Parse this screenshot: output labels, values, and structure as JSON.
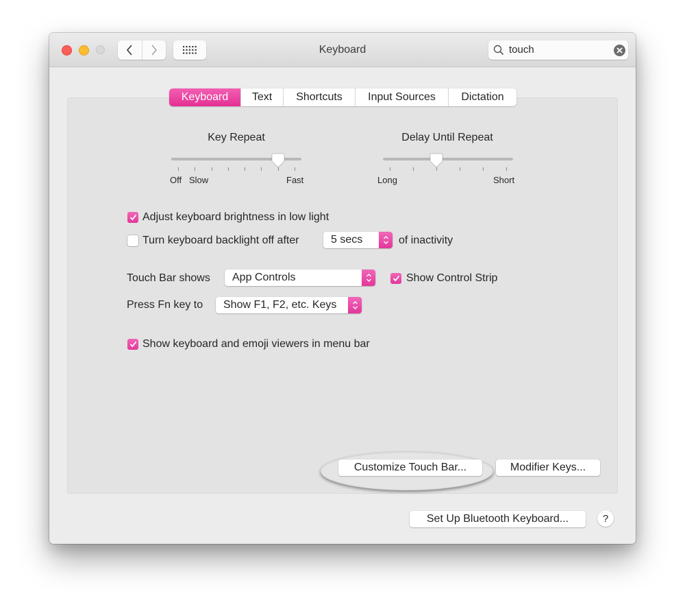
{
  "window": {
    "title": "Keyboard",
    "search": {
      "value": "touch",
      "icon": "magnifier-icon",
      "clear_icon": "clear-circle-icon"
    },
    "traffic_lights": [
      "close",
      "minimize",
      "zoom-disabled"
    ],
    "nav": {
      "back_icon": "chevron-left-icon",
      "forward_icon": "chevron-right-icon",
      "show_all_icon": "grid-icon"
    }
  },
  "tabs": [
    {
      "label": "Keyboard",
      "active": true
    },
    {
      "label": "Text",
      "active": false
    },
    {
      "label": "Shortcuts",
      "active": false
    },
    {
      "label": "Input Sources",
      "active": false
    },
    {
      "label": "Dictation",
      "active": false
    }
  ],
  "sliders": {
    "key_repeat": {
      "title": "Key Repeat",
      "labels": {
        "off": "Off",
        "slow": "Slow",
        "fast": "Fast"
      },
      "tick_count": 8,
      "value_index": 6
    },
    "delay_until_repeat": {
      "title": "Delay Until Repeat",
      "labels": {
        "long": "Long",
        "short": "Short"
      },
      "tick_count": 6,
      "value_index": 2
    }
  },
  "options": {
    "adjust_brightness": {
      "label": "Adjust keyboard brightness in low light",
      "checked": true
    },
    "backlight_off": {
      "label": "Turn keyboard backlight off after",
      "checked": false,
      "popup_value": "5 secs",
      "suffix": "of inactivity"
    },
    "touch_bar_shows": {
      "label": "Touch Bar shows",
      "popup_value": "App Controls"
    },
    "show_control_strip": {
      "label": "Show Control Strip",
      "checked": true
    },
    "press_fn": {
      "label": "Press Fn key to",
      "popup_value": "Show F1, F2, etc. Keys"
    },
    "show_viewers": {
      "label": "Show keyboard and emoji viewers in menu bar",
      "checked": true
    }
  },
  "buttons": {
    "customize_touch_bar": "Customize Touch Bar...",
    "modifier_keys": "Modifier Keys...",
    "bluetooth_keyboard": "Set Up Bluetooth Keyboard...",
    "help": "?"
  },
  "colors": {
    "accent": "#e83f9f",
    "window_bg": "#ececec",
    "panel_bg": "#e3e3e3"
  }
}
